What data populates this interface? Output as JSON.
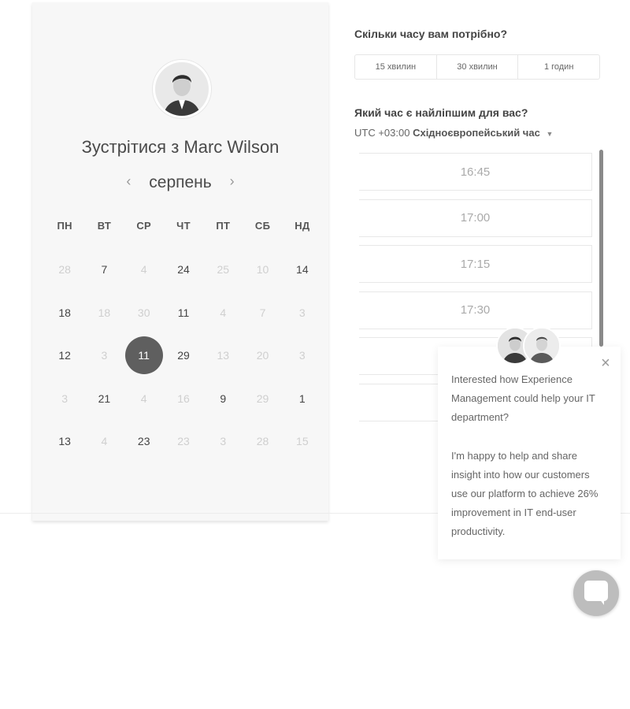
{
  "calendar": {
    "title": "Зустрітися з Marc Wilson",
    "month": "серпень",
    "prev_icon": "chevron-left-icon",
    "next_icon": "chevron-right-icon",
    "weekdays": [
      "ПН",
      "ВТ",
      "СР",
      "ЧТ",
      "ПТ",
      "СБ",
      "НД"
    ],
    "weeks": [
      [
        {
          "d": "28",
          "s": "muted"
        },
        {
          "d": "7",
          "s": "active"
        },
        {
          "d": "4",
          "s": "muted"
        },
        {
          "d": "24",
          "s": "active"
        },
        {
          "d": "25",
          "s": "muted"
        },
        {
          "d": "10",
          "s": "muted"
        },
        {
          "d": "14",
          "s": "active"
        }
      ],
      [
        {
          "d": "18",
          "s": "active"
        },
        {
          "d": "18",
          "s": "muted"
        },
        {
          "d": "30",
          "s": "muted"
        },
        {
          "d": "11",
          "s": "active"
        },
        {
          "d": "4",
          "s": "muted"
        },
        {
          "d": "7",
          "s": "muted"
        },
        {
          "d": "3",
          "s": "muted"
        }
      ],
      [
        {
          "d": "12",
          "s": "active"
        },
        {
          "d": "3",
          "s": "muted"
        },
        {
          "d": "11",
          "s": "selected"
        },
        {
          "d": "29",
          "s": "active"
        },
        {
          "d": "13",
          "s": "muted"
        },
        {
          "d": "20",
          "s": "muted"
        },
        {
          "d": "3",
          "s": "muted"
        }
      ],
      [
        {
          "d": "3",
          "s": "muted"
        },
        {
          "d": "21",
          "s": "active"
        },
        {
          "d": "4",
          "s": "muted"
        },
        {
          "d": "16",
          "s": "muted"
        },
        {
          "d": "9",
          "s": "active"
        },
        {
          "d": "29",
          "s": "muted"
        },
        {
          "d": "1",
          "s": "active"
        }
      ],
      [
        {
          "d": "13",
          "s": "active"
        },
        {
          "d": "4",
          "s": "muted"
        },
        {
          "d": "23",
          "s": "active"
        },
        {
          "d": "23",
          "s": "muted"
        },
        {
          "d": "3",
          "s": "muted"
        },
        {
          "d": "28",
          "s": "muted"
        },
        {
          "d": "15",
          "s": "muted"
        }
      ]
    ]
  },
  "booking": {
    "duration_question": "Скільки часу вам потрібно?",
    "durations": [
      "15 хвилин",
      "30 хвилин",
      "1 годин"
    ],
    "time_question": "Який час є найліпшим для вас?",
    "tz_offset": "UTC +03:00",
    "tz_name": "Східноєвропейський час",
    "slots": [
      "16:45",
      "17:00",
      "17:15",
      "17:30",
      "",
      ""
    ]
  },
  "chat": {
    "message_1": "Interested how Experience Management could help your IT department?",
    "message_2": "I'm happy to help and share insight into how our customers use our platform to achieve 26% improvement in IT end-user productivity.",
    "close_icon": "close-icon",
    "launcher_icon": "chat-bubble-icon"
  },
  "colors": {
    "selected_day": "#5f5f5f",
    "card_bg": "#f7f7f7",
    "muted_day": "#cfcfcf",
    "launcher": "#bdbdbd"
  }
}
